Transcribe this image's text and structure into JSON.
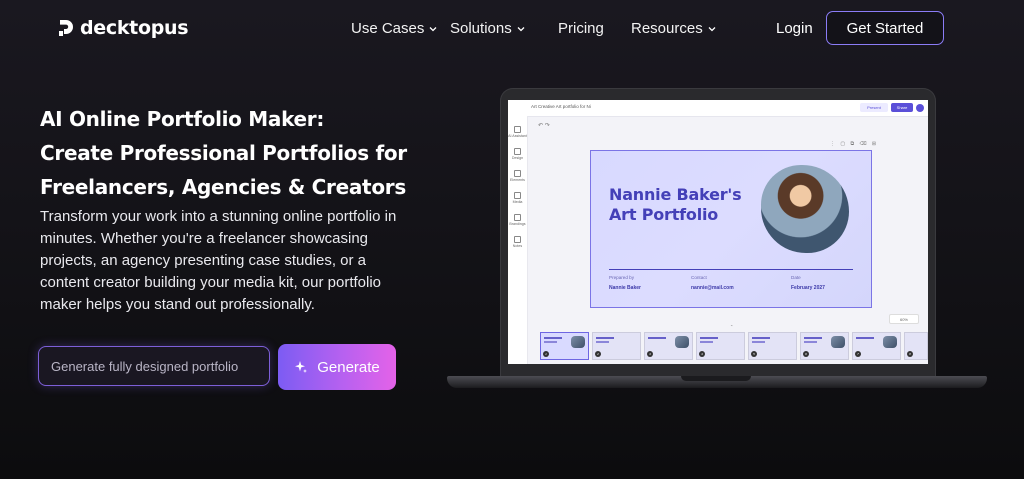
{
  "nav": {
    "brand": "decktopus",
    "items": [
      {
        "label": "Use Cases",
        "dropdown": true
      },
      {
        "label": "Solutions",
        "dropdown": true
      },
      {
        "label": "Pricing",
        "dropdown": false
      },
      {
        "label": "Resources",
        "dropdown": true
      }
    ],
    "login": "Login",
    "cta": "Get Started"
  },
  "hero": {
    "title_lines": [
      "AI Online Portfolio Maker:",
      "Create Professional Portfolios for",
      "Freelancers, Agencies & Creators"
    ],
    "description": "Transform your work into a stunning online portfolio in minutes. Whether you're a freelancer showcasing projects, an agency presenting case studies, or a content creator building your media kit, our portfolio maker helps you stand out professionally.",
    "input_placeholder": "Generate fully designed portfolio",
    "generate_label": "Generate"
  },
  "editor": {
    "doc_title": "Art Creative Art portfolio for Ni",
    "present_label": "Present",
    "share_label": "Share",
    "sidebar": [
      "AI Assistant",
      "Design",
      "Elements",
      "Media",
      "Brandings",
      "Notes"
    ],
    "zoom": "60%",
    "slide": {
      "title_line1": "Nannie Baker's",
      "title_line2": "Art Portfolio",
      "prepared_by_label": "Prepared by",
      "prepared_by_value": "Nannie Baker",
      "contact_label": "Contact",
      "contact_value": "nannie@mail.com",
      "date_label": "Date",
      "date_value": "February 2027"
    },
    "thumbnail_count": 8
  },
  "colors": {
    "accent": "#8b7cf6",
    "slide_text": "#4440b8",
    "generate_gradient_start": "#7c5cf3",
    "generate_gradient_end": "#e462e8"
  }
}
